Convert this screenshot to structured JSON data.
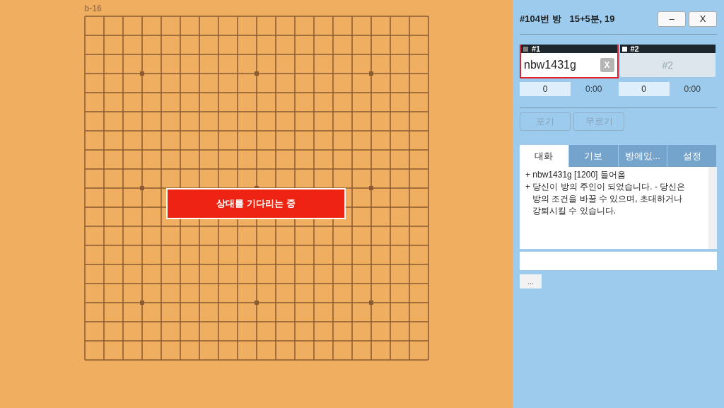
{
  "board": {
    "label": "b-16",
    "banner": "상대를 기다리는 중"
  },
  "room": {
    "title": "#104번 방",
    "settings": "15+5분, 19",
    "buttons": [
      "–",
      "X"
    ]
  },
  "players": [
    {
      "tag": "#1",
      "color": "#808080",
      "name": "nbw1431g",
      "kick": "X",
      "selected": true,
      "empty": false,
      "score": "0",
      "time": "0:00"
    },
    {
      "tag": "#2",
      "color": "#ffffff",
      "name": "#2",
      "selected": false,
      "empty": true,
      "score": "0",
      "time": "0:00"
    }
  ],
  "actions": [
    {
      "label": "포기",
      "disabled": true
    },
    {
      "label": "무르기",
      "disabled": true
    }
  ],
  "tabs": [
    {
      "label": "대화",
      "selected": true
    },
    {
      "label": "기보",
      "selected": false
    },
    {
      "label": "방에있...",
      "selected": false
    },
    {
      "label": "설정",
      "selected": false
    }
  ],
  "chat": [
    "+ nbw1431g [1200] 들어옴",
    "+ 당신이 방의 주인이 되었습니다. - 당신은 방의 조건을 바꿀 수 있으며, 초대하거나 강퇴시킬 수 있습니다."
  ],
  "more_button": "..."
}
